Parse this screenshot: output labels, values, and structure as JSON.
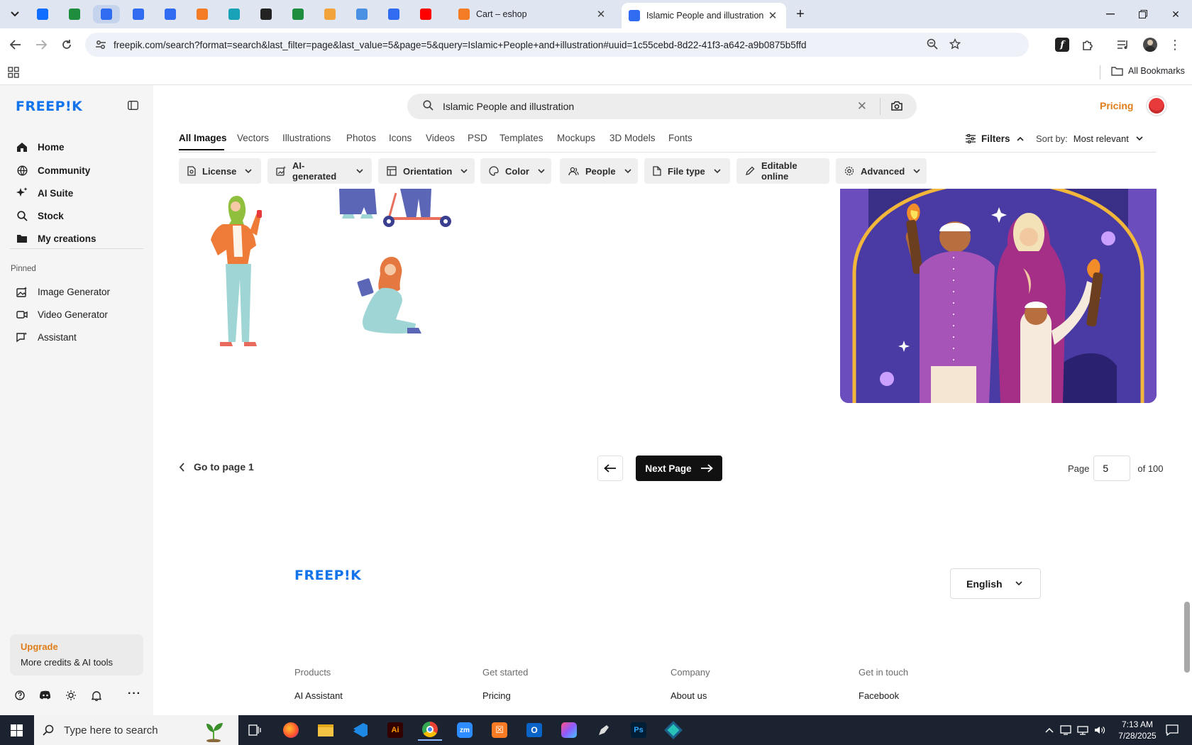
{
  "browser": {
    "tabs": [
      {
        "icon": "wix-icon",
        "color": "#116dff"
      },
      {
        "icon": "sheets-icon",
        "color": "#1e8e3e"
      },
      {
        "icon": "docs-icon",
        "color": "#2f6cf2"
      },
      {
        "icon": "docs-icon",
        "color": "#2f6cf2"
      },
      {
        "icon": "docs-icon",
        "color": "#2f6cf2"
      },
      {
        "icon": "xampp-icon",
        "color": "#f37c24"
      },
      {
        "icon": "app-icon",
        "color": "#17a2b8"
      },
      {
        "icon": "chatgpt-icon",
        "color": "#222222"
      },
      {
        "icon": "sheets-icon",
        "color": "#1e8e3e"
      },
      {
        "icon": "hand-icon",
        "color": "#f2a33a"
      },
      {
        "icon": "grid-app-icon",
        "color": "#4a90e2"
      },
      {
        "icon": "forms-icon",
        "color": "#2f6cf2"
      },
      {
        "icon": "youtube-icon",
        "color": "#ff0000"
      }
    ],
    "cart_tab_title": "Cart – eshop",
    "active_tab_title": "Islamic People and illustration",
    "url": "freepik.com/search?format=search&last_filter=page&last_value=5&page=5&query=Islamic+People+and+illustration#uuid=1c55cebd-8d22-41f3-a642-a9b0875b5ffd",
    "bookmarks_label": "All Bookmarks"
  },
  "sidebar": {
    "logo": "FREEP!K",
    "nav": [
      {
        "label": "Home",
        "icon": "home-icon"
      },
      {
        "label": "Community",
        "icon": "globe-icon"
      },
      {
        "label": "AI Suite",
        "icon": "sparkle-icon"
      },
      {
        "label": "Stock",
        "icon": "search-icon"
      },
      {
        "label": "My creations",
        "icon": "folder-icon"
      }
    ],
    "pinned_label": "Pinned",
    "pinned": [
      {
        "label": "Image Generator",
        "icon": "image-gen-icon"
      },
      {
        "label": "Video Generator",
        "icon": "video-gen-icon"
      },
      {
        "label": "Assistant",
        "icon": "assistant-icon"
      }
    ],
    "upgrade_title": "Upgrade",
    "upgrade_text": "More credits & AI tools"
  },
  "search": {
    "query": "Islamic People and illustration"
  },
  "header": {
    "pricing": "Pricing"
  },
  "category_tabs": [
    "All Images",
    "Vectors",
    "Illustrations",
    "Photos",
    "Icons",
    "Videos",
    "PSD",
    "Templates",
    "Mockups",
    "3D Models",
    "Fonts"
  ],
  "filters_label": "Filters",
  "sort": {
    "label": "Sort by:",
    "value": "Most relevant"
  },
  "filter_chips": [
    "License",
    "AI-generated",
    "Orientation",
    "Color",
    "People",
    "File type",
    "Editable online",
    "Advanced"
  ],
  "pagination": {
    "go_first": "Go to page 1",
    "next": "Next Page",
    "page_label": "Page",
    "current_page": "5",
    "total": "of 100"
  },
  "footer": {
    "logo": "FREEP!K",
    "language": "English",
    "columns": [
      {
        "title": "Products",
        "link": "AI Assistant"
      },
      {
        "title": "Get started",
        "link": "Pricing"
      },
      {
        "title": "Company",
        "link": "About us"
      },
      {
        "title": "Get in touch",
        "link": "Facebook"
      }
    ]
  },
  "taskbar": {
    "search_placeholder": "Type here to search",
    "time": "7:13 AM",
    "date": "7/28/2025"
  },
  "colors": {
    "brand_blue": "#1273eb",
    "pricing_orange": "#e07d1b",
    "upgrade_orange": "#e07d1b"
  }
}
